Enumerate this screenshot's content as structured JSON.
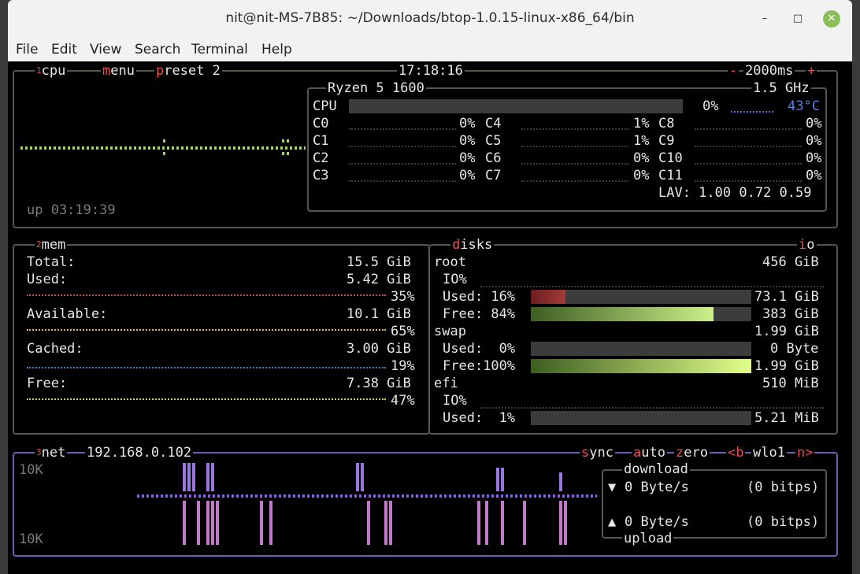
{
  "window": {
    "title": "nit@nit-MS-7B85: ~/Downloads/btop-1.0.15-linux-x86_64/bin",
    "min": "–",
    "max": "□",
    "close": "✕"
  },
  "menu": [
    "File",
    "Edit",
    "View",
    "Search",
    "Terminal",
    "Help"
  ],
  "cpu_box": {
    "num": "1",
    "label": "cpu",
    "menu_first": "m",
    "menu_rest": "enu",
    "preset_first": "p",
    "preset_rest": "reset 2",
    "clock": "17:18:16",
    "minus": "-",
    "interval": "2000ms",
    "plus": "+",
    "uptime": "up 03:19:39",
    "model": "Ryzen 5 1600",
    "freq": "1.5 GHz",
    "total_label": "CPU",
    "total_pct": "0%",
    "total_pct_value": 0,
    "temp": "43°C",
    "cores": [
      {
        "name": "C0",
        "pct": "0%"
      },
      {
        "name": "C1",
        "pct": "0%"
      },
      {
        "name": "C2",
        "pct": "0%"
      },
      {
        "name": "C3",
        "pct": "0%"
      },
      {
        "name": "C4",
        "pct": "1%"
      },
      {
        "name": "C5",
        "pct": "1%"
      },
      {
        "name": "C6",
        "pct": "0%"
      },
      {
        "name": "C7",
        "pct": "0%"
      },
      {
        "name": "C8",
        "pct": "0%"
      },
      {
        "name": "C9",
        "pct": "0%"
      },
      {
        "name": "C10",
        "pct": "0%"
      },
      {
        "name": "C11",
        "pct": "0%"
      }
    ],
    "lav": "LAV: 1.00 0.72 0.59"
  },
  "mem_box": {
    "num": "2",
    "label": "mem",
    "total_label": "Total:",
    "total": "15.5 GiB",
    "used_label": "Used:",
    "used": "5.42 GiB",
    "used_pct": "35%",
    "avail_label": "Available:",
    "avail": "10.1 GiB",
    "avail_pct": "65%",
    "cached_label": "Cached:",
    "cached": "3.00 GiB",
    "cached_pct": "19%",
    "free_label": "Free:",
    "free": "7.38 GiB",
    "free_pct": "47%"
  },
  "disks_box": {
    "label_first": "d",
    "label_rest": "isks",
    "io_first": "i",
    "io_rest": "o",
    "root": {
      "name": "root",
      "size": "456 GiB",
      "io": "IO%",
      "used_label": "Used: 16%",
      "used_value": 16,
      "used": "73.1 GiB",
      "free_label": "Free: 84%",
      "free_value": 84,
      "free": "383 GiB"
    },
    "swap": {
      "name": "swap",
      "size": "1.99 GiB",
      "used_label": "Used:  0%",
      "used_value": 0,
      "used": "0 Byte",
      "free_label": "Free:100%",
      "free_value": 100,
      "free": "1.99 GiB"
    },
    "efi": {
      "name": "efi",
      "size": "510 MiB",
      "io": "IO%",
      "used_label": "Used:  1%",
      "used_value": 1,
      "used": "5.21 MiB"
    }
  },
  "net_box": {
    "num": "3",
    "label": "net",
    "ip": "192.168.0.102",
    "sync_first": "s",
    "sync_rest": "ync",
    "auto_first": "a",
    "auto_rest": "uto",
    "zero_first": "z",
    "zero_rest": "ero",
    "prev": "<b",
    "iface": "wlo1",
    "next": "n>",
    "scale_top": "10K",
    "scale_bottom": "10K",
    "download_label": "download",
    "download_arrow": "▼",
    "download": "0 Byte/s",
    "download_bits": "(0 bitps)",
    "upload_label": "upload",
    "upload_arrow": "▲",
    "upload": "0 Byte/s",
    "upload_bits": "(0 bitps)"
  },
  "colors": {
    "cpu_graph": "#a5d16a",
    "mem_used": "#c0504d",
    "mem_avail": "#e0b83c",
    "mem_cached": "#3d7fb0",
    "mem_free": "#b7d94e",
    "net": "#8a63d2",
    "border_cpu": "#4f5b4a",
    "border_net": "#6a5fb0",
    "accent": "#ee4b4b"
  }
}
